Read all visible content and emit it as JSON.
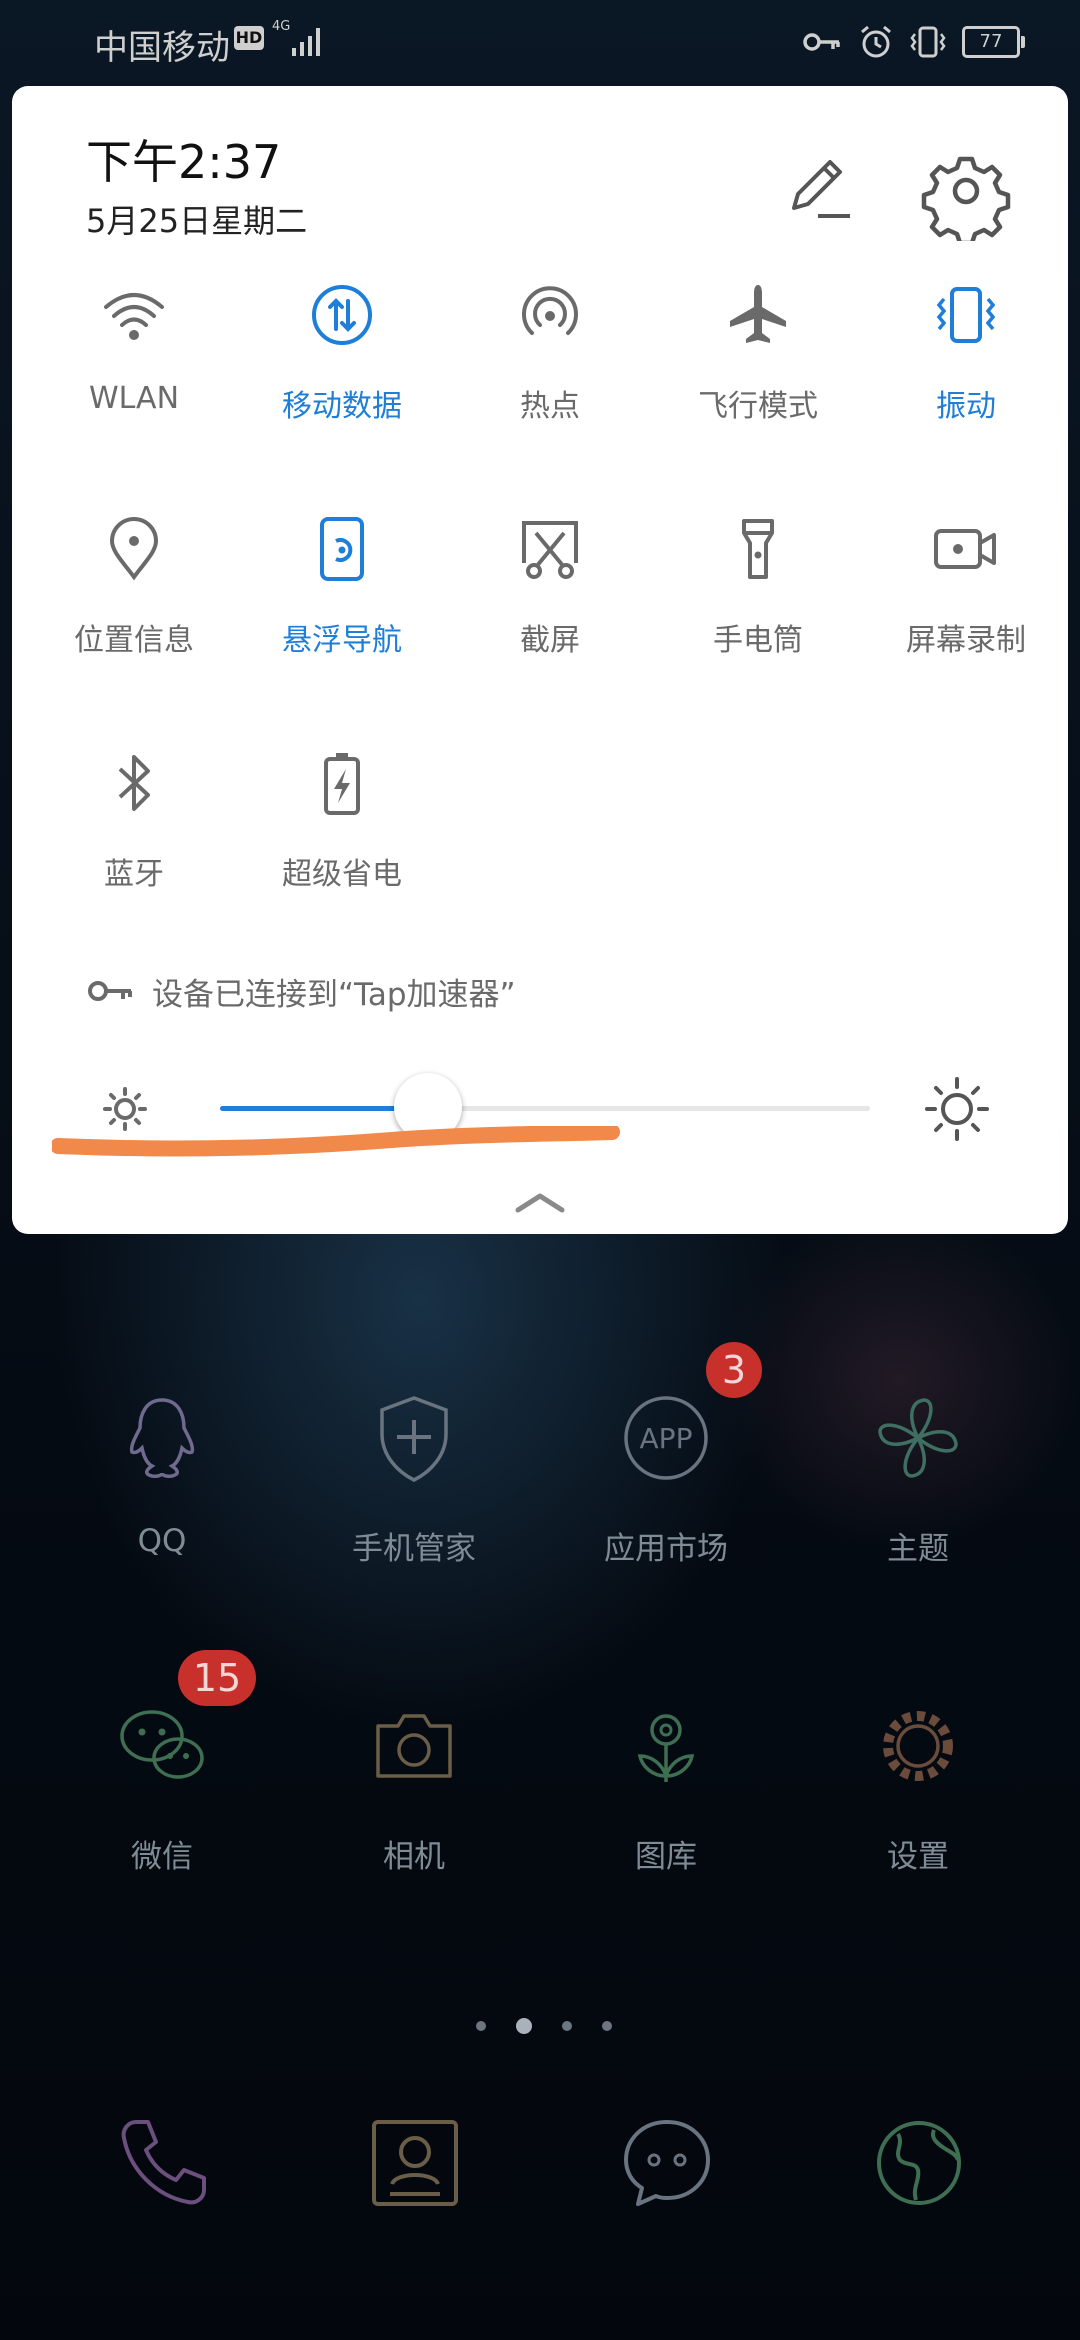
{
  "status_bar": {
    "carrier": "中国移动",
    "hd_label": "HD",
    "network_type": "4G",
    "battery": "77"
  },
  "panel": {
    "time": "下午2:37",
    "date": "5月25日星期二",
    "tiles": [
      {
        "label": "WLAN",
        "icon": "wifi-icon",
        "active": false
      },
      {
        "label": "移动数据",
        "icon": "mobile-data-icon",
        "active": true
      },
      {
        "label": "热点",
        "icon": "hotspot-icon",
        "active": false
      },
      {
        "label": "飞行模式",
        "icon": "airplane-icon",
        "active": false
      },
      {
        "label": "振动",
        "icon": "vibrate-icon",
        "active": true
      },
      {
        "label": "位置信息",
        "icon": "location-icon",
        "active": false
      },
      {
        "label": "悬浮导航",
        "icon": "floating-nav-icon",
        "active": true
      },
      {
        "label": "截屏",
        "icon": "screenshot-icon",
        "active": false
      },
      {
        "label": "手电筒",
        "icon": "flashlight-icon",
        "active": false
      },
      {
        "label": "屏幕录制",
        "icon": "screen-record-icon",
        "active": false
      },
      {
        "label": "蓝牙",
        "icon": "bluetooth-icon",
        "active": false
      },
      {
        "label": "超级省电",
        "icon": "battery-saver-icon",
        "active": false
      }
    ],
    "vpn_notice": "设备已连接到“Tap加速器”",
    "brightness_fraction": 0.32,
    "accent_color": "#1e7ed8",
    "annotation_color": "#f0894a"
  },
  "home": {
    "apps": [
      {
        "label": "QQ",
        "icon": "qq-icon"
      },
      {
        "label": "手机管家",
        "icon": "shield-plus-icon"
      },
      {
        "label": "应用市场",
        "icon": "app-market-icon",
        "badge": "3"
      },
      {
        "label": "主题",
        "icon": "theme-icon"
      },
      {
        "label": "微信",
        "icon": "wechat-icon",
        "badge": "15"
      },
      {
        "label": "相机",
        "icon": "camera-icon"
      },
      {
        "label": "图库",
        "icon": "gallery-icon"
      },
      {
        "label": "设置",
        "icon": "settings-gear-icon"
      }
    ],
    "app_market_icon_text": "APP",
    "dock": [
      "phone-icon",
      "contacts-icon",
      "messages-icon",
      "browser-icon"
    ]
  }
}
